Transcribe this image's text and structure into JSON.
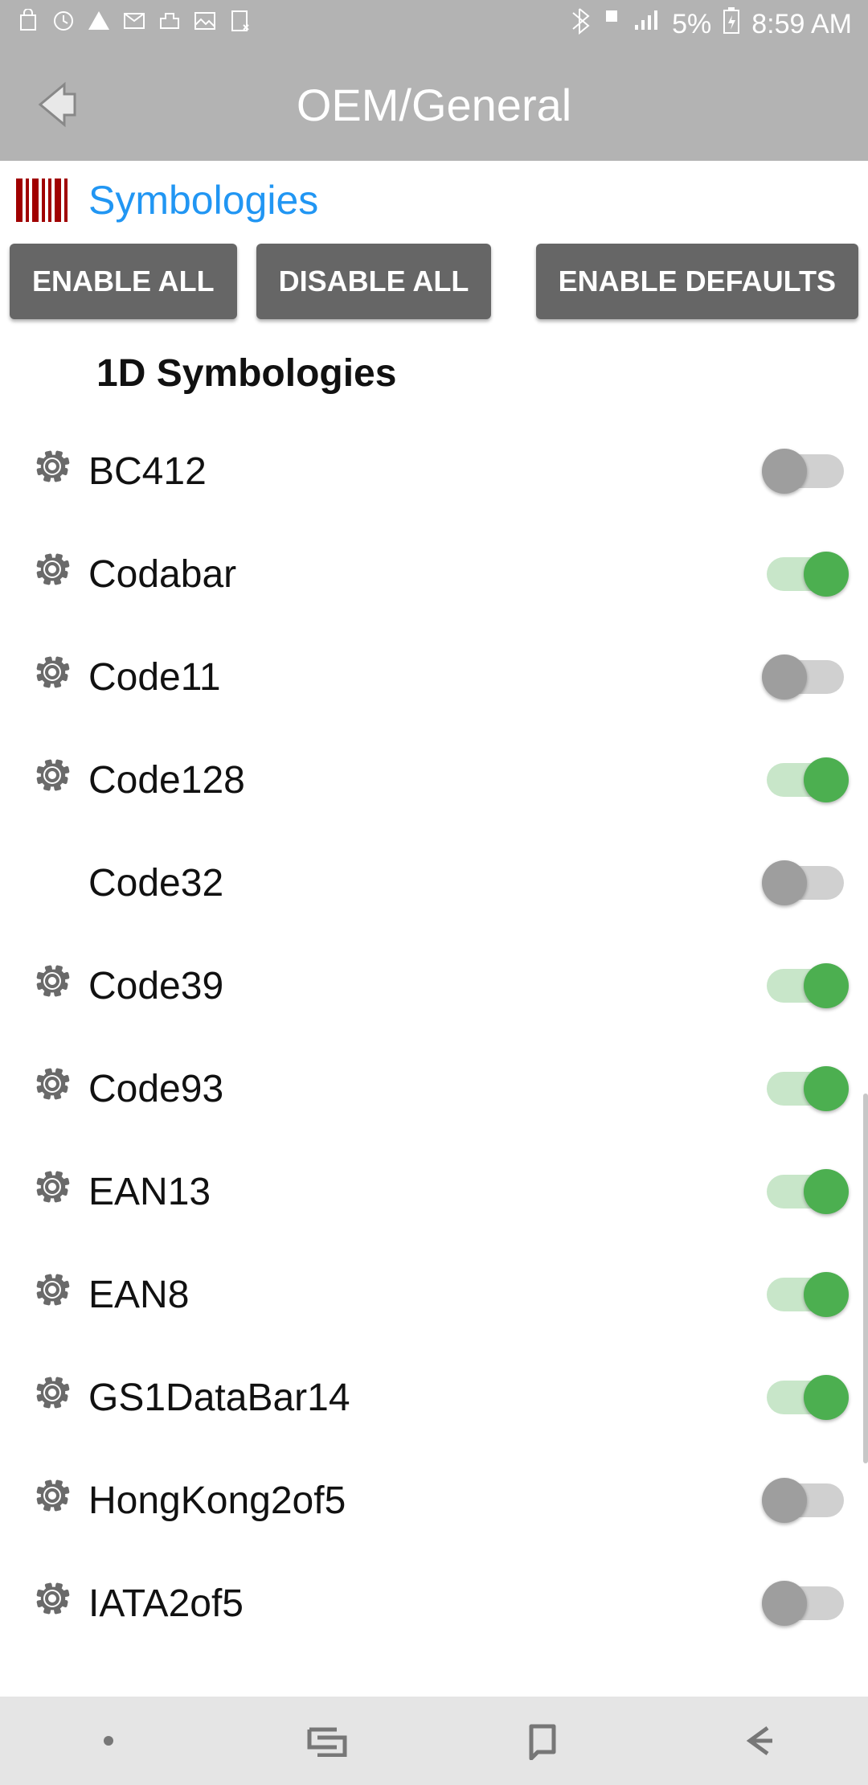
{
  "status": {
    "battery": "5%",
    "time": "8:59 AM"
  },
  "header": {
    "title": "OEM/General"
  },
  "sub": {
    "title": "Symbologies"
  },
  "buttons": {
    "enable_all": "ENABLE ALL",
    "disable_all": "DISABLE ALL",
    "enable_defaults": "ENABLE DEFAULTS"
  },
  "section": {
    "title": "1D Symbologies"
  },
  "rows": [
    {
      "label": "BC412",
      "gear": true,
      "on": false
    },
    {
      "label": "Codabar",
      "gear": true,
      "on": true
    },
    {
      "label": "Code11",
      "gear": true,
      "on": false
    },
    {
      "label": "Code128",
      "gear": true,
      "on": true
    },
    {
      "label": "Code32",
      "gear": false,
      "on": false
    },
    {
      "label": "Code39",
      "gear": true,
      "on": true
    },
    {
      "label": "Code93",
      "gear": true,
      "on": true
    },
    {
      "label": "EAN13",
      "gear": true,
      "on": true
    },
    {
      "label": "EAN8",
      "gear": true,
      "on": true
    },
    {
      "label": "GS1DataBar14",
      "gear": true,
      "on": true
    },
    {
      "label": "HongKong2of5",
      "gear": true,
      "on": false
    },
    {
      "label": "IATA2of5",
      "gear": true,
      "on": false
    }
  ],
  "colors": {
    "accent": "#4CAF50",
    "link": "#2196F3",
    "bar": "#b3b3b3",
    "btn": "#666"
  }
}
